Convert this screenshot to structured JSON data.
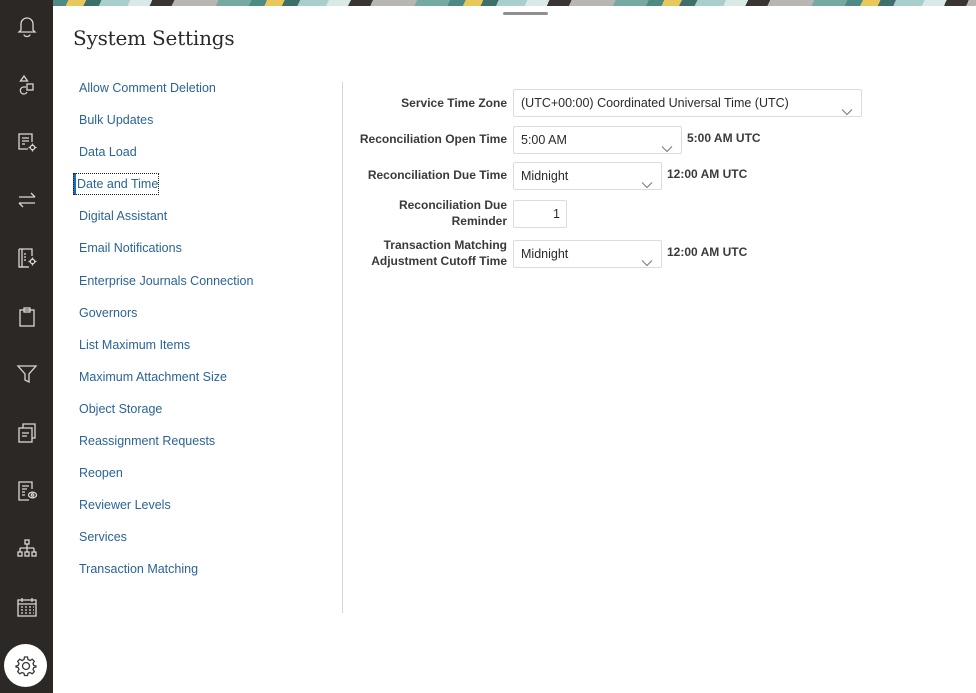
{
  "nav_rail": {
    "items": [
      {
        "icon": "bell-icon",
        "label": "Notifications"
      },
      {
        "icon": "shapes-workflow-icon",
        "label": "Workflow"
      },
      {
        "icon": "document-settings-icon",
        "label": "Document Settings"
      },
      {
        "icon": "transfer-arrows-icon",
        "label": "Transfers"
      },
      {
        "icon": "book-settings-icon",
        "label": "Book Settings"
      },
      {
        "icon": "clipboard-icon",
        "label": "Clipboard"
      },
      {
        "icon": "filter-icon",
        "label": "Filter"
      },
      {
        "icon": "copy-documents-icon",
        "label": "Documents"
      },
      {
        "icon": "report-view-icon",
        "label": "Report View"
      },
      {
        "icon": "hierarchy-icon",
        "label": "Hierarchy"
      },
      {
        "icon": "calendar-icon",
        "label": "Calendar"
      },
      {
        "icon": "gear-icon",
        "label": "Settings",
        "active": true
      }
    ]
  },
  "page": {
    "title": "System Settings"
  },
  "settings_list": {
    "selected": "Date and Time",
    "items": [
      "Allow Comment Deletion",
      "Bulk Updates",
      "Data Load",
      "Date and Time",
      "Digital Assistant",
      "Email Notifications",
      "Enterprise Journals Connection",
      "Governors",
      "List Maximum Items",
      "Maximum Attachment Size",
      "Object Storage",
      "Reassignment Requests",
      "Reopen",
      "Reviewer Levels",
      "Services",
      "Transaction Matching"
    ]
  },
  "form": {
    "service_time_zone": {
      "label": "Service Time Zone",
      "value": "(UTC+00:00) Coordinated Universal Time (UTC)"
    },
    "reconciliation_open_time": {
      "label": "Reconciliation Open Time",
      "value": "5:00 AM",
      "utc_note": "5:00 AM UTC"
    },
    "reconciliation_due_time": {
      "label": "Reconciliation Due Time",
      "value": "Midnight",
      "utc_note": "12:00 AM UTC"
    },
    "reconciliation_due_reminder": {
      "label_line1": "Reconciliation Due",
      "label_line2": "Reminder",
      "value": "1"
    },
    "tm_adjustment_cutoff_time": {
      "label_line1": "Transaction Matching",
      "label_line2": "Adjustment Cutoff Time",
      "value": "Midnight",
      "utc_note": "12:00 AM UTC"
    }
  }
}
